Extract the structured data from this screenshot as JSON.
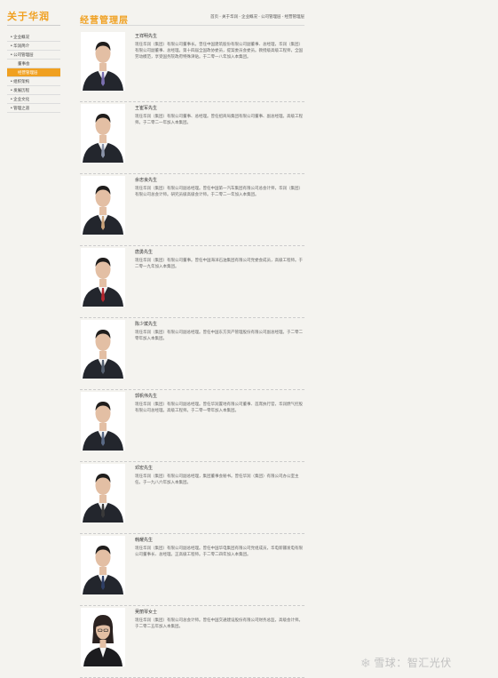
{
  "sidebar": {
    "title": "关于华润",
    "items": [
      {
        "label": "企业概况",
        "level": 0,
        "active": false
      },
      {
        "label": "华润简介",
        "level": 0,
        "active": false
      },
      {
        "label": "公司管理层",
        "level": 0,
        "active": false
      },
      {
        "label": "董事会",
        "level": 1,
        "active": false
      },
      {
        "label": "经营管理层",
        "level": 1,
        "active": true
      },
      {
        "label": "组织架构",
        "level": 0,
        "active": false
      },
      {
        "label": "发展历程",
        "level": 0,
        "active": false
      },
      {
        "label": "企业文化",
        "level": 0,
        "active": false
      },
      {
        "label": "管理之道",
        "level": 0,
        "active": false
      }
    ]
  },
  "header": {
    "title": "经营管理层",
    "breadcrumb": "首页 - 关于华润 - 企业概况 - 公司管理层 - 经营管理层"
  },
  "executives": [
    {
      "name": "王祥明先生",
      "bio": "现任华润（集团）有限公司董事长。曾任中国建筑股份有限公司副董事、总经理，华润（集团）有限公司副董事、总经理。第十四届全国政协委员，提案委员会委员。教授级高级工程师，全国劳动模范，享受国务院政府特殊津贴。于二零一八年加入本集团。",
      "tie": "#7a6fb0"
    },
    {
      "name": "王崔军先生",
      "bio": "现任华润（集团）有限公司董事、总经理。曾任招商局集团有限公司董事、副总经理。高级工程师。于二零二一年加入本集团。",
      "tie": "#8a93a8"
    },
    {
      "name": "余忠良先生",
      "bio": "现任华润（集团）有限公司副总经理。曾任中国第一汽车集团有限公司总会计师，华润（集团）有限公司总会计师。研究员级高级会计师。于二零二一年加入本集团。",
      "tie": "#c9a27a"
    },
    {
      "name": "唐勇先生",
      "bio": "现任华润（集团）有限公司董事。曾任中国海洋石油集团有限公司党委会成员，高级工程师。于二零一九年加入本集团。",
      "tie": "#b3262e"
    },
    {
      "name": "陈少斌先生",
      "bio": "现任华润（集团）有限公司副总经理。曾任中国东方资产管理股份有限公司副总经理。于二零二零年加入本集团。",
      "tie": "#556070"
    },
    {
      "name": "郭帆伟先生",
      "bio": "现任华润（集团）有限公司副总经理。曾任华润置地有限公司董事、首席执行官，华润燃气控股有限公司总经理。高级工程师。于二零一零年加入本集团。",
      "tie": "#5a6a86"
    },
    {
      "name": "邓宏先生",
      "bio": "现任华润（集团）有限公司副总经理，集团董事会秘书。曾任华润（集团）有限公司办公室主任。于一九八六年加入本集团。",
      "tie": "#3a3a3a"
    },
    {
      "name": "韩耀先生",
      "bio": "现任华润（集团）有限公司副总经理。曾任中国华电集团有限公司党组成员，华电新疆发电有限公司董事长、总经理。正高级工程师。于二零二四年加入本集团。",
      "tie": "#2f3f66"
    },
    {
      "name": "吴丽琴女士",
      "bio": "现任华润（集团）有限公司总会计师。曾任中国交通建设股份有限公司财务总监，高级会计师。于二零二五年加入本集团。",
      "tie": null
    }
  ],
  "watermark": "雪球：智汇光伏"
}
